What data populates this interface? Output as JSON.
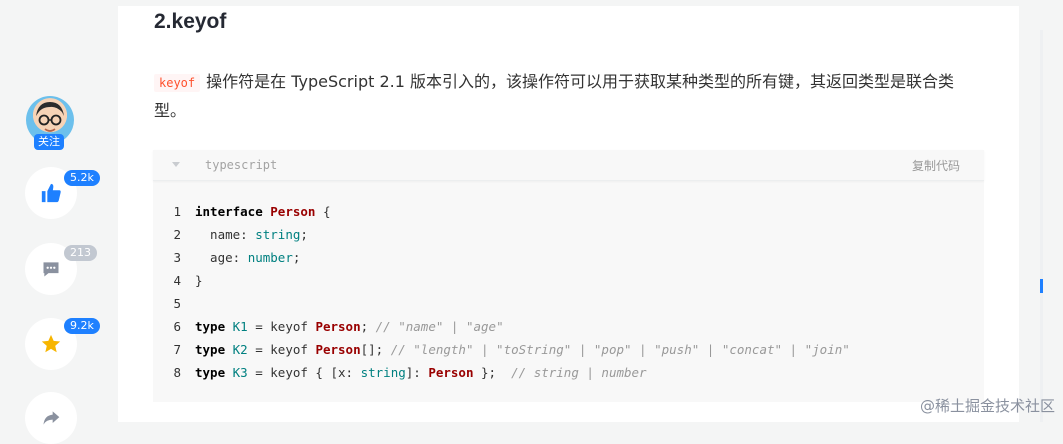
{
  "heading": "2.keyof",
  "paragraph": {
    "code": "keyof",
    "text": "操作符是在 TypeScript 2.1 版本引入的，该操作符可以用于获取某种类型的所有键，其返回类型是联合类型。"
  },
  "rail": {
    "follow_label": "关注",
    "like_count": "5.2k",
    "comment_count": "213",
    "collect_count": "9.2k"
  },
  "code_block": {
    "language": "typescript",
    "copy_label": "复制代码",
    "lines": [
      {
        "n": "1",
        "tokens": [
          [
            "kw",
            "interface"
          ],
          [
            "pl",
            " "
          ],
          [
            "ty",
            "Person"
          ],
          [
            "pl",
            " {"
          ]
        ]
      },
      {
        "n": "2",
        "tokens": [
          [
            "pl",
            "  name: "
          ],
          [
            "id",
            "string"
          ],
          [
            "pl",
            ";"
          ]
        ]
      },
      {
        "n": "3",
        "tokens": [
          [
            "pl",
            "  age: "
          ],
          [
            "id",
            "number"
          ],
          [
            "pl",
            ";"
          ]
        ]
      },
      {
        "n": "4",
        "tokens": [
          [
            "pl",
            "}"
          ]
        ]
      },
      {
        "n": "5",
        "tokens": []
      },
      {
        "n": "6",
        "tokens": [
          [
            "kw",
            "type"
          ],
          [
            "pl",
            " "
          ],
          [
            "id",
            "K1"
          ],
          [
            "pl",
            " = keyof "
          ],
          [
            "ty",
            "Person"
          ],
          [
            "pl",
            "; "
          ],
          [
            "cm",
            "// \"name\" | \"age\""
          ]
        ]
      },
      {
        "n": "7",
        "tokens": [
          [
            "kw",
            "type"
          ],
          [
            "pl",
            " "
          ],
          [
            "id",
            "K2"
          ],
          [
            "pl",
            " = keyof "
          ],
          [
            "ty",
            "Person"
          ],
          [
            "pl",
            "[]; "
          ],
          [
            "cm",
            "// \"length\" | \"toString\" | \"pop\" | \"push\" | \"concat\" | \"join\""
          ]
        ]
      },
      {
        "n": "8",
        "tokens": [
          [
            "kw",
            "type"
          ],
          [
            "pl",
            " "
          ],
          [
            "id",
            "K3"
          ],
          [
            "pl",
            " = keyof { [x: "
          ],
          [
            "id",
            "string"
          ],
          [
            "pl",
            "]: "
          ],
          [
            "ty",
            "Person"
          ],
          [
            "pl",
            " };  "
          ],
          [
            "cm",
            "// string | number"
          ]
        ]
      }
    ]
  },
  "watermark": "@稀土掘金技术社区",
  "colors": {
    "accent": "#1e80ff",
    "keyword": "#000000",
    "type_name": "#990000",
    "identifier": "#008080",
    "comment": "#999999",
    "inline_code": "#ff502c"
  },
  "icons": {
    "like": "thumbs-up-icon",
    "comment": "comment-icon",
    "collect": "star-icon",
    "share": "share-icon",
    "collapse": "caret-down-icon"
  }
}
